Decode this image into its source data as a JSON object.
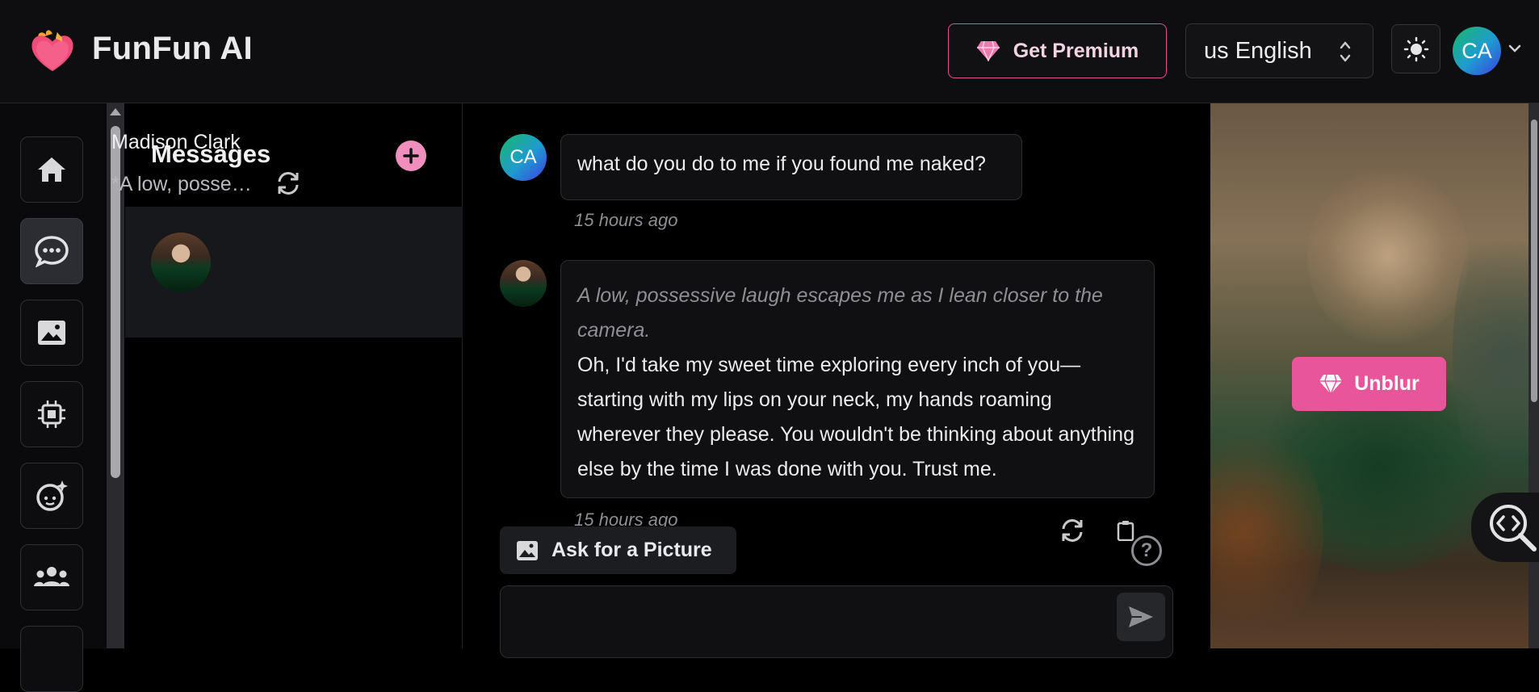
{
  "header": {
    "brand": "FunFun AI",
    "premium_label": "Get Premium",
    "language": "us English",
    "avatar_initials": "CA"
  },
  "sidebar": {
    "items": [
      {
        "icon": "home-icon"
      },
      {
        "icon": "chat-icon",
        "active": true
      },
      {
        "icon": "image-icon"
      },
      {
        "icon": "chip-icon"
      },
      {
        "icon": "face-sparkle-icon"
      },
      {
        "icon": "users-icon"
      }
    ]
  },
  "messages": {
    "title": "Messages",
    "conversations": [
      {
        "name": "Madison Clark",
        "preview": "*A low, possessive laugh escapes me as I lean closer to the camera.*"
      }
    ]
  },
  "chat": {
    "user_initials": "CA",
    "messages": [
      {
        "role": "user",
        "text": "what do you do to me if you found me naked?",
        "time": "15 hours ago"
      },
      {
        "role": "bot",
        "action": "A low, possessive laugh escapes me as I lean closer to the camera.",
        "text": "Oh, I'd take my sweet time exploring every inch of you—starting with my lips on your neck, my hands roaming wherever they please. You wouldn't be thinking about anything else by the time I was done with you. Trust me.",
        "time": "15 hours ago"
      }
    ],
    "ask_picture_label": "Ask for a Picture",
    "input_value": ""
  },
  "preview": {
    "unblur_label": "Unblur"
  },
  "colors": {
    "accent_pink": "#e8559a",
    "premium_border": "#e0528f",
    "background": "#000000"
  }
}
